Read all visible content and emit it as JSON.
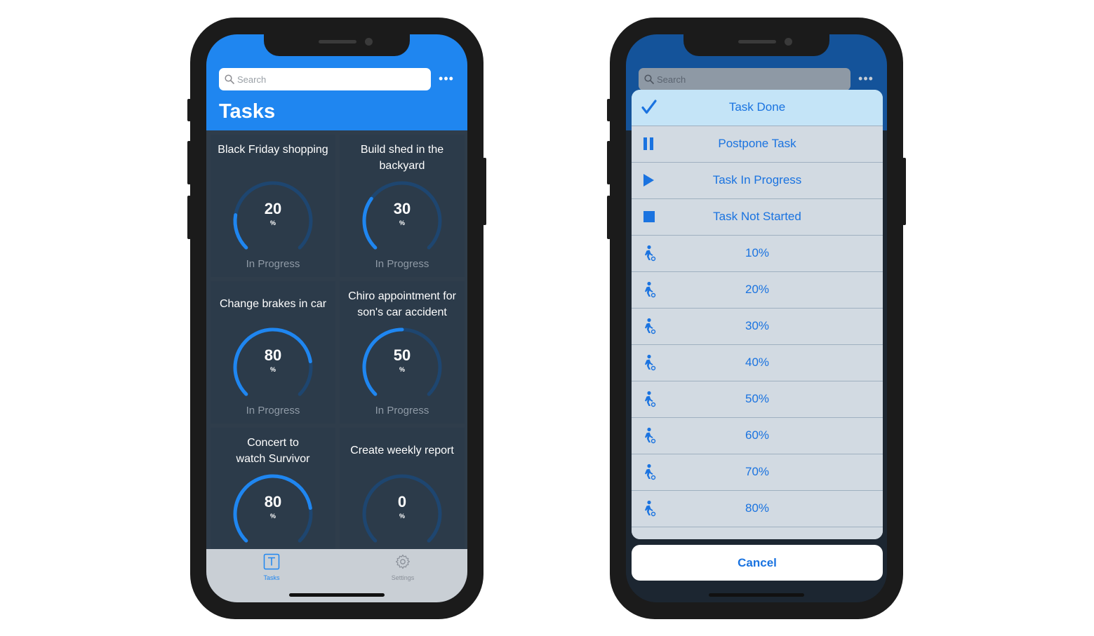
{
  "left_phone": {
    "search_placeholder": "Search",
    "more_label": "•••",
    "title": "Tasks",
    "tasks": [
      {
        "name": "Black Friday shopping",
        "percent": "20",
        "percent_value": 20,
        "unit": "%",
        "status": "In Progress"
      },
      {
        "name": "Build shed in the backyard",
        "percent": "30",
        "percent_value": 30,
        "unit": "%",
        "status": "In Progress"
      },
      {
        "name": "Change brakes in car",
        "percent": "80",
        "percent_value": 80,
        "unit": "%",
        "status": "In Progress"
      },
      {
        "name": "Chiro appointment for son's car accident",
        "percent": "50",
        "percent_value": 50,
        "unit": "%",
        "status": "In Progress"
      },
      {
        "name": "Concert to watch Survivor",
        "percent": "80",
        "percent_value": 80,
        "unit": "%",
        "status": ""
      },
      {
        "name": "Create weekly report",
        "percent": "0",
        "percent_value": 0,
        "unit": "%",
        "status": ""
      }
    ],
    "tabs": [
      {
        "label": "Tasks",
        "icon": "t-square-icon",
        "active": true
      },
      {
        "label": "Settings",
        "icon": "gear-icon",
        "active": false
      }
    ]
  },
  "right_phone": {
    "search_placeholder": "Search",
    "more_label": "•••",
    "actions": [
      {
        "label": "Task Done",
        "icon": "checkmark-icon"
      },
      {
        "label": "Postpone Task",
        "icon": "pause-icon"
      },
      {
        "label": "Task In Progress",
        "icon": "play-icon"
      },
      {
        "label": "Task Not Started",
        "icon": "stop-icon"
      },
      {
        "label": "10%",
        "icon": "worker-icon"
      },
      {
        "label": "20%",
        "icon": "worker-icon"
      },
      {
        "label": "30%",
        "icon": "worker-icon"
      },
      {
        "label": "40%",
        "icon": "worker-icon"
      },
      {
        "label": "50%",
        "icon": "worker-icon"
      },
      {
        "label": "60%",
        "icon": "worker-icon"
      },
      {
        "label": "70%",
        "icon": "worker-icon"
      },
      {
        "label": "80%",
        "icon": "worker-icon"
      }
    ],
    "cancel_label": "Cancel"
  },
  "colors": {
    "accent": "#1f86f0",
    "tile_bg": "#2c3b4a",
    "gauge_track": "#1e4670",
    "gauge_fill": "#1f86f0",
    "action_text": "#1a73e0"
  }
}
